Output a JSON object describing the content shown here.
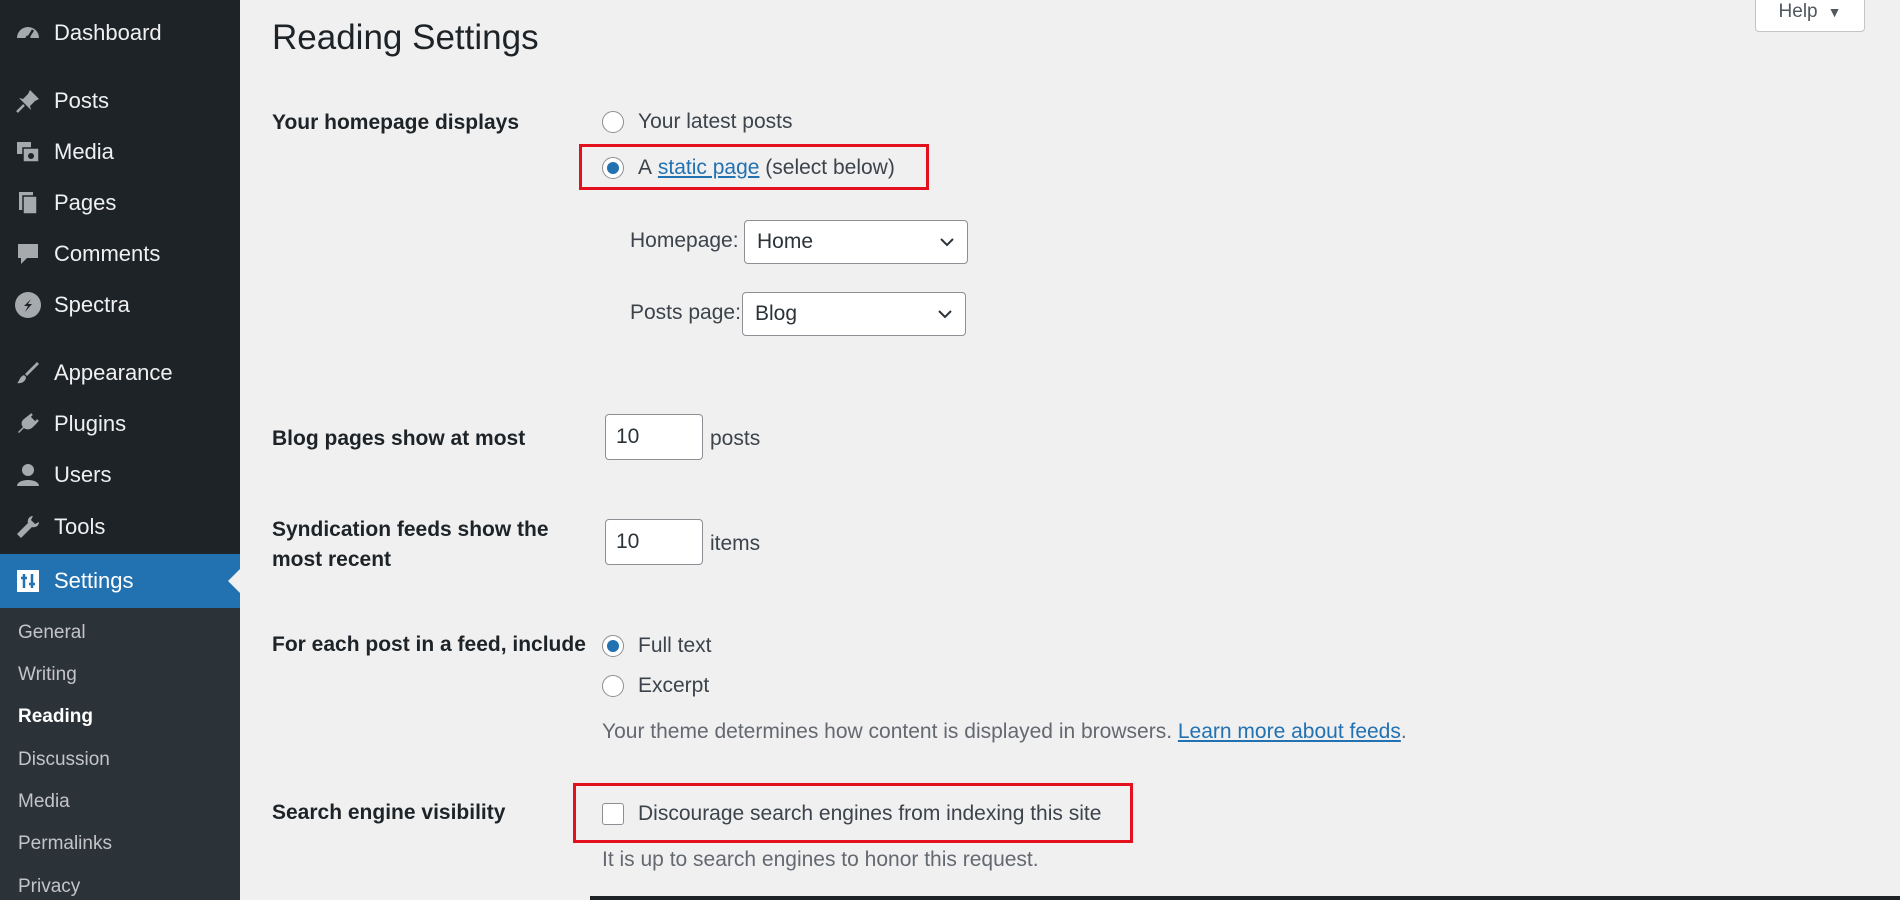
{
  "sidebar": {
    "items": [
      {
        "label": "Dashboard",
        "icon": "dashboard-icon"
      },
      {
        "label": "Posts",
        "icon": "pin-icon"
      },
      {
        "label": "Media",
        "icon": "media-icon"
      },
      {
        "label": "Pages",
        "icon": "pages-icon"
      },
      {
        "label": "Comments",
        "icon": "comment-icon"
      },
      {
        "label": "Spectra",
        "icon": "spectra-icon"
      },
      {
        "label": "Appearance",
        "icon": "brush-icon"
      },
      {
        "label": "Plugins",
        "icon": "plug-icon"
      },
      {
        "label": "Users",
        "icon": "user-icon"
      },
      {
        "label": "Tools",
        "icon": "wrench-icon"
      },
      {
        "label": "Settings",
        "icon": "settings-icon"
      }
    ],
    "active_item": "Settings",
    "submenu": [
      "General",
      "Writing",
      "Reading",
      "Discussion",
      "Media",
      "Permalinks",
      "Privacy"
    ],
    "current_submenu": "Reading"
  },
  "header": {
    "title": "Reading Settings",
    "help_label": "Help",
    "help_arrow": "▼"
  },
  "homepage_displays": {
    "label": "Your homepage displays",
    "option_latest": "Your latest posts",
    "option_static_prefix": "A",
    "option_static_link": "static page",
    "option_static_suffix": "(select below)",
    "selected": "static",
    "homepage_label": "Homepage:",
    "homepage_value": "Home",
    "posts_page_label": "Posts page:",
    "posts_page_value": "Blog"
  },
  "blog_pages": {
    "label": "Blog pages show at most",
    "value": "10",
    "suffix": "posts"
  },
  "syndication": {
    "label_line1": "Syndication feeds show the",
    "label_line2": "most recent",
    "value": "10",
    "suffix": "items"
  },
  "feed_include": {
    "label": "For each post in a feed, include",
    "option_full": "Full text",
    "option_excerpt": "Excerpt",
    "selected": "full",
    "description": "Your theme determines how content is displayed in browsers.",
    "link": "Learn more about feeds",
    "link_suffix": "."
  },
  "search_visibility": {
    "label": "Search engine visibility",
    "checkbox_label": "Discourage search engines from indexing this site",
    "checked": false,
    "description": "It is up to search engines to honor this request."
  },
  "colors": {
    "sidebar_bg": "#1d2327",
    "accent": "#2271b1",
    "highlight_border": "#e3101e"
  }
}
